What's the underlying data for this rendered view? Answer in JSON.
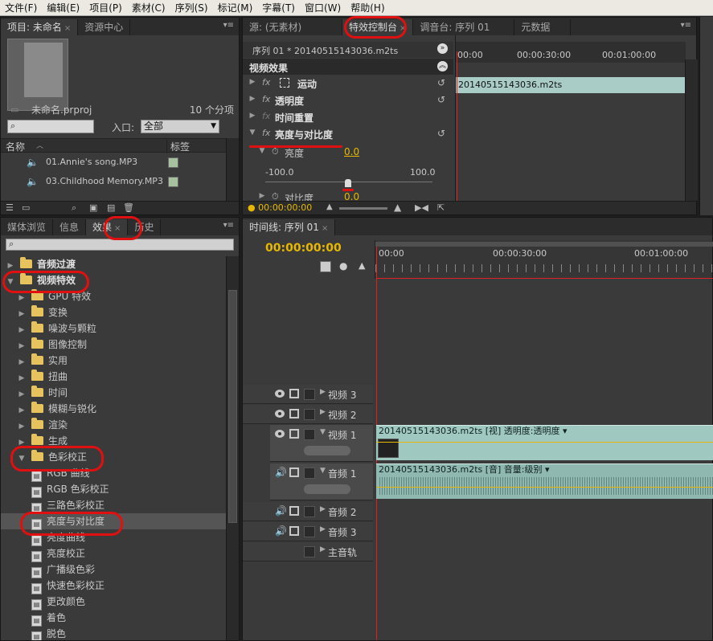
{
  "menu": [
    "文件(F)",
    "编辑(E)",
    "项目(P)",
    "素材(C)",
    "序列(S)",
    "标记(M)",
    "字幕(T)",
    "窗口(W)",
    "帮助(H)"
  ],
  "project": {
    "tabs": [
      "项目: 未命名",
      "资源中心"
    ],
    "file": "未命名.prproj",
    "count": "10 个分项",
    "entry_label": "入口:",
    "entry_value": "全部",
    "col_name": "名称",
    "col_label": "标签",
    "items": [
      "01.Annie's song.MP3",
      "03.Childhood Memory.MP3"
    ]
  },
  "effect_controls": {
    "tabs": [
      "源: (无素材)",
      "特效控制台",
      "调音台: 序列 01",
      "元数据"
    ],
    "sequence_title": "序列 01 * 20140515143036.m2ts",
    "section": "视频效果",
    "effects": [
      "运动",
      "透明度",
      "时间重置",
      "亮度与对比度"
    ],
    "param_brightness": "亮度",
    "param_brightness_value": "0.0",
    "slider_min": "-100.0",
    "slider_max": "100.0",
    "param_contrast": "对比度",
    "param_contrast_value": "0.0",
    "timecode": "00:00:00:00",
    "ruler": [
      "00:00",
      "00:00:30:00",
      "00:01:00:00"
    ],
    "clip_name": "20140515143036.m2ts"
  },
  "effects_panel": {
    "tabs": [
      "媒体浏览",
      "信息",
      "效果",
      "历史"
    ],
    "tree": [
      {
        "label": "音频过渡",
        "level": 0,
        "type": "folder",
        "open": false
      },
      {
        "label": "视频特效",
        "level": 0,
        "type": "folder",
        "open": true
      },
      {
        "label": "GPU 特效",
        "level": 1,
        "type": "folder",
        "open": false
      },
      {
        "label": "变换",
        "level": 1,
        "type": "folder",
        "open": false
      },
      {
        "label": "噪波与颗粒",
        "level": 1,
        "type": "folder",
        "open": false
      },
      {
        "label": "图像控制",
        "level": 1,
        "type": "folder",
        "open": false
      },
      {
        "label": "实用",
        "level": 1,
        "type": "folder",
        "open": false
      },
      {
        "label": "扭曲",
        "level": 1,
        "type": "folder",
        "open": false
      },
      {
        "label": "时间",
        "level": 1,
        "type": "folder",
        "open": false
      },
      {
        "label": "模糊与锐化",
        "level": 1,
        "type": "folder",
        "open": false
      },
      {
        "label": "渲染",
        "level": 1,
        "type": "folder",
        "open": false
      },
      {
        "label": "生成",
        "level": 1,
        "type": "folder",
        "open": false
      },
      {
        "label": "色彩校正",
        "level": 1,
        "type": "folder",
        "open": true
      },
      {
        "label": "RGB 曲线",
        "level": 2,
        "type": "effect"
      },
      {
        "label": "RGB 色彩校正",
        "level": 2,
        "type": "effect"
      },
      {
        "label": "三路色彩校正",
        "level": 2,
        "type": "effect"
      },
      {
        "label": "亮度与对比度",
        "level": 2,
        "type": "effect",
        "selected": true
      },
      {
        "label": "亮度曲线",
        "level": 2,
        "type": "effect"
      },
      {
        "label": "亮度校正",
        "level": 2,
        "type": "effect"
      },
      {
        "label": "广播级色彩",
        "level": 2,
        "type": "effect"
      },
      {
        "label": "快速色彩校正",
        "level": 2,
        "type": "effect"
      },
      {
        "label": "更改颜色",
        "level": 2,
        "type": "effect"
      },
      {
        "label": "着色",
        "level": 2,
        "type": "effect"
      },
      {
        "label": "脱色",
        "level": 2,
        "type": "effect"
      }
    ]
  },
  "timeline": {
    "tab": "时间线: 序列 01",
    "timecode": "00:00:00:00",
    "ruler": [
      "00:00",
      "00:00:30:00",
      "00:01:00:00"
    ],
    "tracks": [
      "视频 3",
      "视频 2",
      "视频 1",
      "音频 1",
      "音频 2",
      "音频 3",
      "主音轨"
    ],
    "video_clip": "20140515143036.m2ts [视] 透明度:透明度 ▾",
    "audio_clip": "20140515143036.m2ts [音] 音量:级别 ▾"
  },
  "colors": {
    "accent": "#e8b800",
    "annotation": "#e01010",
    "clip": "#9fc8c0",
    "playhead": "#e02020"
  }
}
